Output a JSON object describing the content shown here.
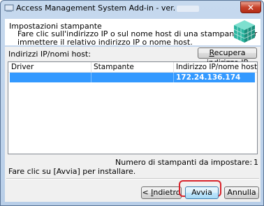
{
  "window": {
    "title": "Access Management System Add-in - ver.",
    "close_glyph": "✕"
  },
  "header": {
    "title": "Impostazioni stampante",
    "description": "Fare clic sull'indirizzo IP o sul nome host di una stampante per\nimmettere il relativo indirizzo IP o nome host.",
    "logo_icon": "printer-cube-icon"
  },
  "list_label": "Indirizzi IP/nomi host:",
  "recupera_button": {
    "underlined": "R",
    "rest": "ecupera indirizzo IP"
  },
  "table": {
    "columns": [
      "Driver",
      "Stampante",
      "Indirizzo IP/nome host"
    ],
    "rows": [
      {
        "driver": "",
        "stampante": "",
        "ip": "172.24.136.174",
        "selected": true
      }
    ]
  },
  "count_label": "Numero di stampanti da impostare:",
  "count_value": "1",
  "instruction": "Fare clic su [Avvia] per installare.",
  "buttons": {
    "back_prefix": "< ",
    "back_underlined": "I",
    "back_rest": "ndietro",
    "start": "Avvia",
    "cancel": "Annulla"
  },
  "colors": {
    "selection": "#3399ff",
    "highlight": "#d8242c",
    "logo": "#2bb5a0"
  }
}
